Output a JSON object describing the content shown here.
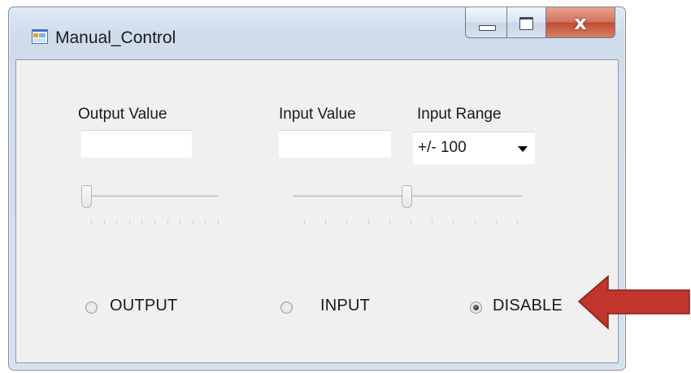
{
  "window": {
    "title": "Manual_Control",
    "close_glyph": "x",
    "icon": "app-window-icon"
  },
  "fields": {
    "output_value_label": "Output Value",
    "output_value": "",
    "input_value_label": "Input Value",
    "input_value": "",
    "input_range_label": "Input Range",
    "input_range_selected": "+/- 100"
  },
  "sliders": {
    "output_level": 0.0,
    "input_level": 0.5
  },
  "modes": {
    "output_label": "OUTPUT",
    "input_label": "INPUT",
    "disable_label": "DISABLE",
    "selected": "DISABLE"
  },
  "colors": {
    "annotation_arrow": "#c0362c",
    "close_button": "#c75037"
  }
}
